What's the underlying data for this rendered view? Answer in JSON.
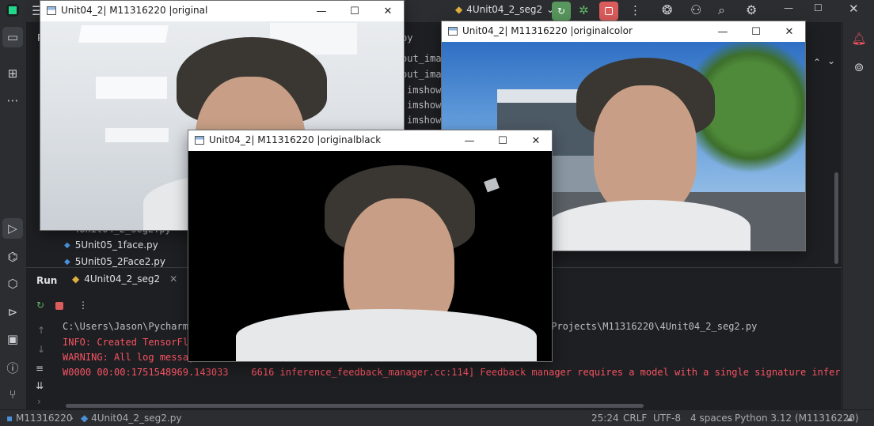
{
  "ide": {
    "run_config": "4Unit04_2_seg2",
    "editor_tab_partial": "P",
    "editor_lines": [
      "out_imag",
      "out_imag",
      "imshow",
      "imshow",
      "imshow"
    ],
    "editor_lines_right": [
      "py"
    ],
    "project_files": [
      "5Unit05_1face.py",
      "5Unit05_2Face2.py"
    ],
    "project_partial": "4Unit04_2_seg2.py"
  },
  "run": {
    "label": "Run",
    "tab": "4Unit04_2_seg2",
    "console": [
      {
        "left": "C:\\Users\\Jason\\PycharmP",
        "right": "nProjects\\M11316220\\4Unit04_2_seg2.py",
        "color": "#bcbec4"
      },
      {
        "left": "INFO: Created TensorFlo",
        "right": "",
        "color": "#f75464"
      },
      {
        "left": "WARNING: All log messag",
        "right": "",
        "color": "#f75464"
      },
      {
        "left": "W0000 00:00:1751548969.143033    6616 inference_feedback_manager.cc:114] Feedback manager requires a model with a single signature inferenc",
        "right": "",
        "color": "#f75464"
      }
    ]
  },
  "status": {
    "project": "M11316220",
    "file": "4Unit04_2_seg2.py",
    "position": "25:24",
    "line_sep": "CRLF",
    "encoding": "UTF-8",
    "indent": "4 spaces",
    "interpreter": "Python 3.12 (M11316220)"
  },
  "windows": {
    "original": {
      "title": "Unit04_2| M11316220 |original"
    },
    "originalcolor": {
      "title": "Unit04_2| M11316220 |originalcolor"
    },
    "originalblack": {
      "title": "Unit04_2| M11316220 |originalblack"
    }
  }
}
